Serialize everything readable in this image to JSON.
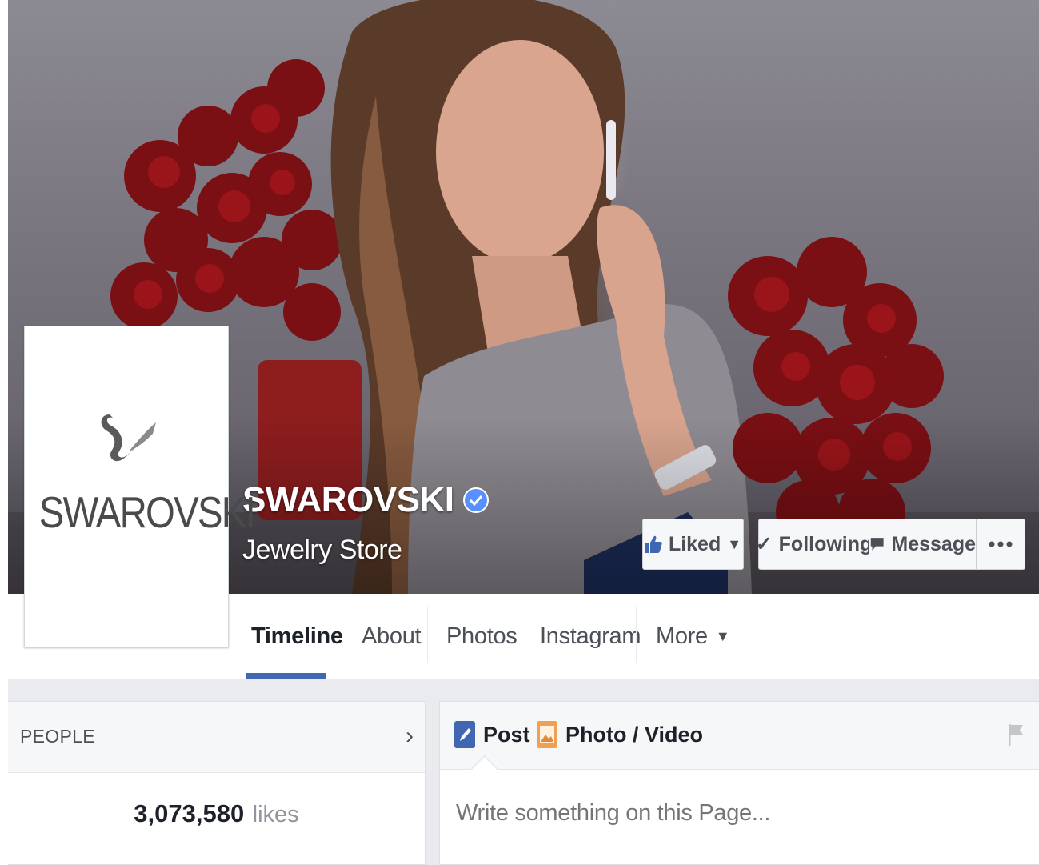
{
  "page": {
    "name": "SWAROVSKI",
    "category": "Jewelry Store",
    "profile_logo_text": "SWAROVSKI"
  },
  "actions": {
    "liked_label": "Liked",
    "following_label": "Following",
    "message_label": "Message"
  },
  "tabs": [
    {
      "label": "Timeline"
    },
    {
      "label": "About"
    },
    {
      "label": "Photos"
    },
    {
      "label": "Instagram"
    },
    {
      "label": "More"
    }
  ],
  "people": {
    "title": "PEOPLE",
    "likes_count": "3,073,580",
    "likes_label": "likes"
  },
  "composer": {
    "post_label": "Post",
    "photo_video_label": "Photo / Video",
    "placeholder": "Write something on this Page..."
  },
  "colors": {
    "accent": "#4267b2",
    "verified": "#5890ff",
    "rose": "#8b1015"
  }
}
